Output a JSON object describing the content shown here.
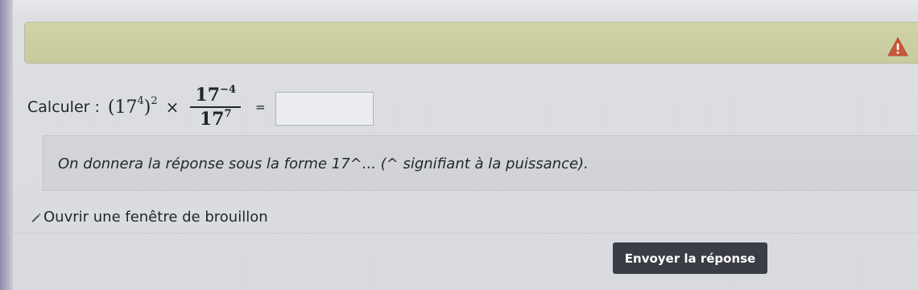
{
  "colors": {
    "warning_icon": "#c9573b",
    "banner_bg": "#cfd3a6",
    "submit_bg": "#3a3d45",
    "submit_text": "#ffffff"
  },
  "banner": {
    "icon": "warning-icon"
  },
  "question": {
    "label": "Calculer :",
    "base": "17",
    "exp_inner": "4",
    "exp_outer": "2",
    "times": "×",
    "numerator_base": "17",
    "numerator_exp": "−4",
    "denominator_base": "17",
    "denominator_exp": "7",
    "equals": "=",
    "answer_value": ""
  },
  "hint": {
    "text": "On donnera la réponse sous la forme 17^... (^ signifiant à la puissance)."
  },
  "draft": {
    "icon": "pencil-icon",
    "label": "Ouvrir une fenêtre de brouillon"
  },
  "submit": {
    "label": "Envoyer la réponse"
  }
}
